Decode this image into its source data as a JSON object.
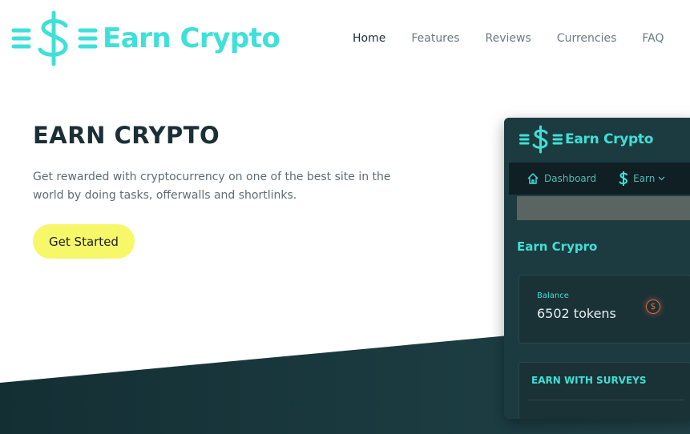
{
  "brand": {
    "name": "Earn Crypto",
    "color": "#3fe0d8"
  },
  "nav": {
    "items": [
      {
        "label": "Home",
        "active": true
      },
      {
        "label": "Features",
        "active": false
      },
      {
        "label": "Reviews",
        "active": false
      },
      {
        "label": "Currencies",
        "active": false
      },
      {
        "label": "FAQ",
        "active": false
      }
    ]
  },
  "hero": {
    "title": "EARN CRYPTO",
    "description": "Get rewarded with cryptocurrency on one of the best site in the world by doing tasks, offerwalls and shortlinks.",
    "cta_label": "Get Started",
    "cta_color": "#f7f76a"
  },
  "mockup": {
    "logo_text": "Earn Crypto",
    "nav": {
      "dashboard_label": "Dashboard",
      "earn_label": "Earn"
    },
    "heading": "Earn Crypro",
    "balance": {
      "label": "Balance",
      "value": "6502 tokens",
      "coin_icon": "dollar-coin-icon"
    },
    "surveys_title": "EARN WITH SURVEYS"
  },
  "colors": {
    "dark_band": "#1a3a3f",
    "mockup_bg": "#1c3b40",
    "accent": "#40dfd6"
  }
}
